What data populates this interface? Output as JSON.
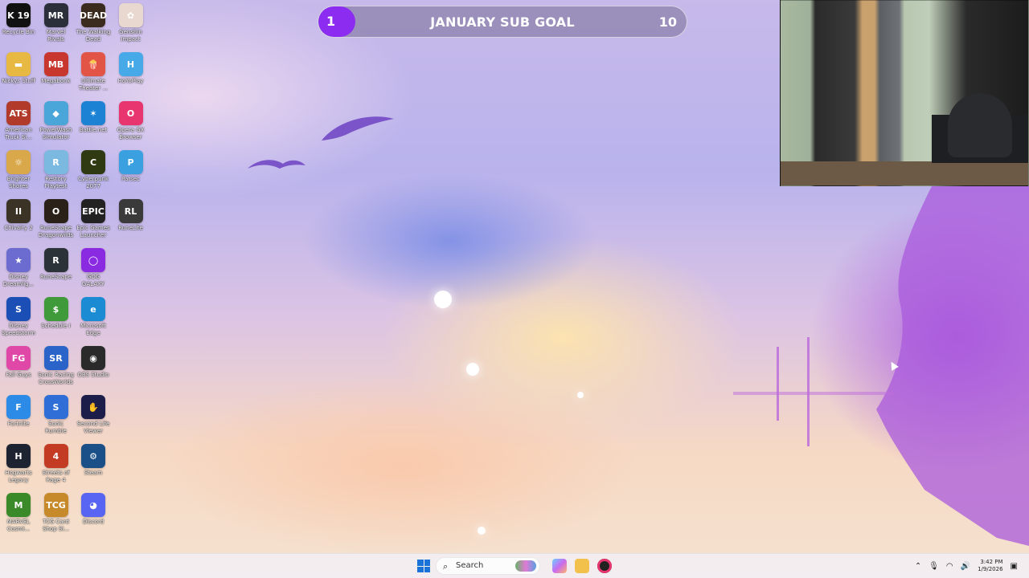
{
  "desktop": {
    "icons": [
      {
        "label": "Recycle Bin",
        "icon": "recycle-bin-icon",
        "glyph": "K 19",
        "color": "#111111"
      },
      {
        "label": "Marvel Rivals",
        "icon": "marvel-rivals-icon",
        "glyph": "MR",
        "color": "#2a2f3a"
      },
      {
        "label": "The Walking Dead",
        "icon": "walking-dead-icon",
        "glyph": "DEAD",
        "color": "#3b2b1e"
      },
      {
        "label": "Genshin Impact",
        "icon": "genshin-impact-icon",
        "glyph": "✿",
        "color": "#e9d8cf"
      },
      {
        "label": "Nickys Stuff",
        "icon": "folder-icon",
        "glyph": "▬",
        "color": "#e8b942"
      },
      {
        "label": "Megabonk",
        "icon": "megabonk-icon",
        "glyph": "MB",
        "color": "#c8372d"
      },
      {
        "label": "Ultimate Theater ...",
        "icon": "theater-icon",
        "glyph": "🍿",
        "color": "#e25546"
      },
      {
        "label": "HoYoPlay",
        "icon": "hoyoplay-icon",
        "glyph": "H",
        "color": "#47a9e8"
      },
      {
        "label": "American Truck Si...",
        "icon": "american-truck-icon",
        "glyph": "ATS",
        "color": "#b23a2a"
      },
      {
        "label": "PowerWash Simulator",
        "icon": "powerwash-icon",
        "glyph": "◆",
        "color": "#4aa6d8"
      },
      {
        "label": "Battle.net",
        "icon": "battlenet-icon",
        "glyph": "✶",
        "color": "#1c82d4"
      },
      {
        "label": "Opera GX Browser",
        "icon": "opera-gx-icon",
        "glyph": "O",
        "color": "#e8356f"
      },
      {
        "label": "Brighter Shores",
        "icon": "brighter-shores-icon",
        "glyph": "☼",
        "color": "#d9a84a"
      },
      {
        "label": "Restory Playtest",
        "icon": "restory-icon",
        "glyph": "R",
        "color": "#7bb9e0"
      },
      {
        "label": "Cyberpunk 2077",
        "icon": "cyberpunk-icon",
        "glyph": "C",
        "color": "#2f3a12"
      },
      {
        "label": "Parsec",
        "icon": "parsec-icon",
        "glyph": "P",
        "color": "#3aa0e0"
      },
      {
        "label": "Chivalry 2",
        "icon": "chivalry-icon",
        "glyph": "II",
        "color": "#3b3326"
      },
      {
        "label": "RuneScape Dragonwilds",
        "icon": "dragonwilds-icon",
        "glyph": "O",
        "color": "#2a2218"
      },
      {
        "label": "Epic Games Launcher",
        "icon": "epic-games-icon",
        "glyph": "EPIC",
        "color": "#222222"
      },
      {
        "label": "RuneLite",
        "icon": "runelite-icon",
        "glyph": "RL",
        "color": "#3a3a3a"
      },
      {
        "label": "Disney Dreamlig...",
        "icon": "disney-dreamlight-icon",
        "glyph": "★",
        "color": "#6b6bd0"
      },
      {
        "label": "RuneScape",
        "icon": "runescape-icon",
        "glyph": "R",
        "color": "#2c3338"
      },
      {
        "label": "GOG GALAXY",
        "icon": "gog-galaxy-icon",
        "glyph": "◯",
        "color": "#8a2be2"
      },
      {
        "label": "",
        "icon": "",
        "glyph": "",
        "color": ""
      },
      {
        "label": "Disney Speedstorm",
        "icon": "speedstorm-icon",
        "glyph": "S",
        "color": "#1c4fb5"
      },
      {
        "label": "Schedule I",
        "icon": "schedule-i-icon",
        "glyph": "$",
        "color": "#3f9a3a"
      },
      {
        "label": "Microsoft Edge",
        "icon": "edge-icon",
        "glyph": "e",
        "color": "#1b8bd4"
      },
      {
        "label": "",
        "icon": "",
        "glyph": "",
        "color": ""
      },
      {
        "label": "Fall Guys",
        "icon": "fall-guys-icon",
        "glyph": "FG",
        "color": "#e048a8"
      },
      {
        "label": "Sonic Racing CrossWorlds",
        "icon": "sonic-racing-icon",
        "glyph": "SR",
        "color": "#2b64c9"
      },
      {
        "label": "OBS Studio",
        "icon": "obs-icon",
        "glyph": "◉",
        "color": "#2a2a2a"
      },
      {
        "label": "",
        "icon": "",
        "glyph": "",
        "color": ""
      },
      {
        "label": "Fortnite",
        "icon": "fortnite-icon",
        "glyph": "F",
        "color": "#2b8be6"
      },
      {
        "label": "Sonic Rumble",
        "icon": "sonic-rumble-icon",
        "glyph": "S",
        "color": "#2f6ed6"
      },
      {
        "label": "Second Life Viewer",
        "icon": "second-life-icon",
        "glyph": "✋",
        "color": "#1d1d4a"
      },
      {
        "label": "",
        "icon": "",
        "glyph": "",
        "color": ""
      },
      {
        "label": "Hogwarts Legacy",
        "icon": "hogwarts-icon",
        "glyph": "H",
        "color": "#1d2330"
      },
      {
        "label": "Streets of Rage 4",
        "icon": "streets-of-rage-icon",
        "glyph": "4",
        "color": "#c23b22"
      },
      {
        "label": "Steam",
        "icon": "steam-icon",
        "glyph": "⚙",
        "color": "#1b4f87"
      },
      {
        "label": "",
        "icon": "",
        "glyph": "",
        "color": ""
      },
      {
        "label": "MARVEL Cosmi...",
        "icon": "marvel-cosmic-icon",
        "glyph": "M",
        "color": "#3a8a2a"
      },
      {
        "label": "TCG Card Shop Si...",
        "icon": "tcg-card-shop-icon",
        "glyph": "TCG",
        "color": "#c78a2a"
      },
      {
        "label": "Discord",
        "icon": "discord-icon",
        "glyph": "◕",
        "color": "#5865f2"
      }
    ]
  },
  "goal": {
    "current": "1",
    "title": "JANUARY SUB GOAL",
    "target": "10",
    "progress_fraction": 0.1,
    "fill_color": "#8b2cf0"
  },
  "taskbar": {
    "search_placeholder": "Search",
    "apps": [
      "copilot-icon",
      "file-explorer-icon",
      "opera-gx-icon"
    ],
    "time": "3:42 PM",
    "date": "1/9/2026"
  }
}
